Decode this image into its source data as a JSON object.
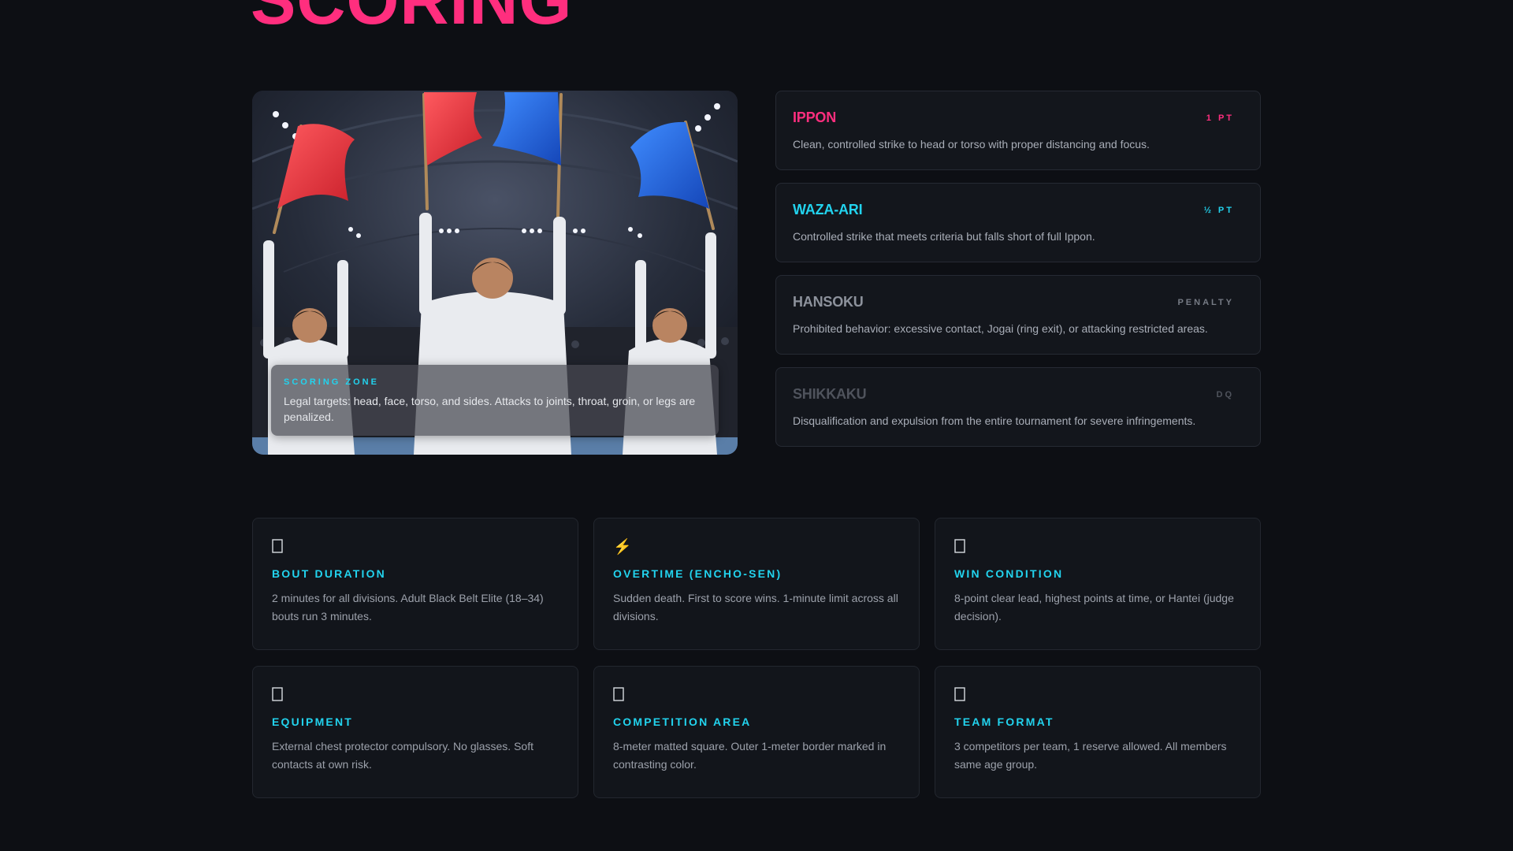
{
  "heading": "SCORING",
  "hero": {
    "caption_kicker": "SCORING ZONE",
    "caption_text": "Legal targets: head, face, torso, and sides. Attacks to joints, throat, groin, or legs are penalized."
  },
  "scores": [
    {
      "name": "IPPON",
      "tag": "1 PT",
      "text": "Clean, controlled strike to head or torso with proper distancing and focus.",
      "color": "#ff2e7e",
      "tag_color": "#ff2e7e"
    },
    {
      "name": "WAZA-ARI",
      "tag": "½ PT",
      "text": "Controlled strike that meets criteria but falls short of full Ippon.",
      "color": "#22d3ee",
      "tag_color": "#22d3ee"
    },
    {
      "name": "HANSOKU",
      "tag": "PENALTY",
      "text": "Prohibited behavior: excessive contact, Jogai (ring exit), or attacking restricted areas.",
      "color": "#8d929c",
      "tag_color": "#767b85"
    },
    {
      "name": "SHIKKAKU",
      "tag": "DQ",
      "text": "Disqualification and expulsion from the entire tournament for severe infringements.",
      "color": "#4f535c",
      "tag_color": "#4f535c"
    }
  ],
  "rules": [
    {
      "icon": "timer-icon",
      "glyph": "box",
      "title": "BOUT DURATION",
      "body": "2 minutes for all divisions. Adult Black Belt Elite (18–34) bouts run 3 minutes."
    },
    {
      "icon": "lightning-icon",
      "glyph": "⚡",
      "title": "OVERTIME (ENCHO-SEN)",
      "body": "Sudden death. First to score wins. 1-minute limit across all divisions."
    },
    {
      "icon": "trophy-icon",
      "glyph": "box",
      "title": "WIN CONDITION",
      "body": "8-point clear lead, highest points at time, or Hantei (judge decision)."
    },
    {
      "icon": "shield-icon",
      "glyph": "box",
      "title": "EQUIPMENT",
      "body": "External chest protector compulsory. No glasses. Soft contacts at own risk."
    },
    {
      "icon": "square-mat-icon",
      "glyph": "box",
      "title": "COMPETITION AREA",
      "body": "8-meter matted square. Outer 1-meter border marked in contrasting color."
    },
    {
      "icon": "team-icon",
      "glyph": "box",
      "title": "TEAM FORMAT",
      "body": "3 competitors per team, 1 reserve allowed. All members same age group."
    }
  ],
  "colors": {
    "background": "#0d0f14",
    "accent_pink": "#ff2e7e",
    "accent_cyan": "#22d3ee",
    "flag_red": "#e8353d",
    "flag_blue": "#1f5fd6"
  }
}
